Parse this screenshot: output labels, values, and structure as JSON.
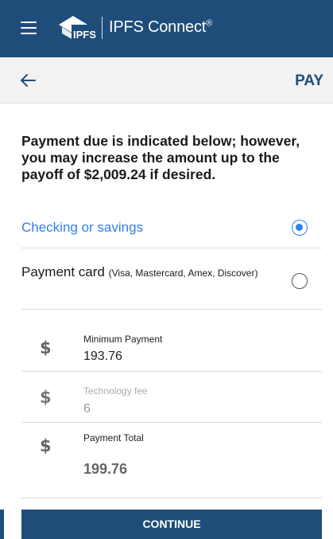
{
  "header": {
    "brand_name": "IPFS Connect",
    "brand_mark": "®",
    "logo_text": "IPFS",
    "menu_icon": "hamburger-menu-icon",
    "bg_color": "#1f4d7a"
  },
  "subheader": {
    "title": "PAY",
    "back_icon": "back-arrow-icon"
  },
  "intro_text": "Payment due is indicated below; however, you may increase the amount up to the payoff of $2,009.24 if desired.",
  "payment_methods": [
    {
      "label": "Checking or savings",
      "detail": "",
      "selected": true
    },
    {
      "label": "Payment card",
      "detail": "(Visa, Mastercard, Amex, Discover)",
      "selected": false
    }
  ],
  "amounts": {
    "currency_symbol": "$",
    "minimum": {
      "label": "Minimum Payment",
      "value": "193.76"
    },
    "fee": {
      "label": "Technology fee",
      "value": "6"
    },
    "total": {
      "label": "Payment Total",
      "value": "199.76"
    }
  },
  "continue_label": "CONTINUE",
  "colors": {
    "primary": "#1f4d7a",
    "accent": "#2f80ed"
  }
}
